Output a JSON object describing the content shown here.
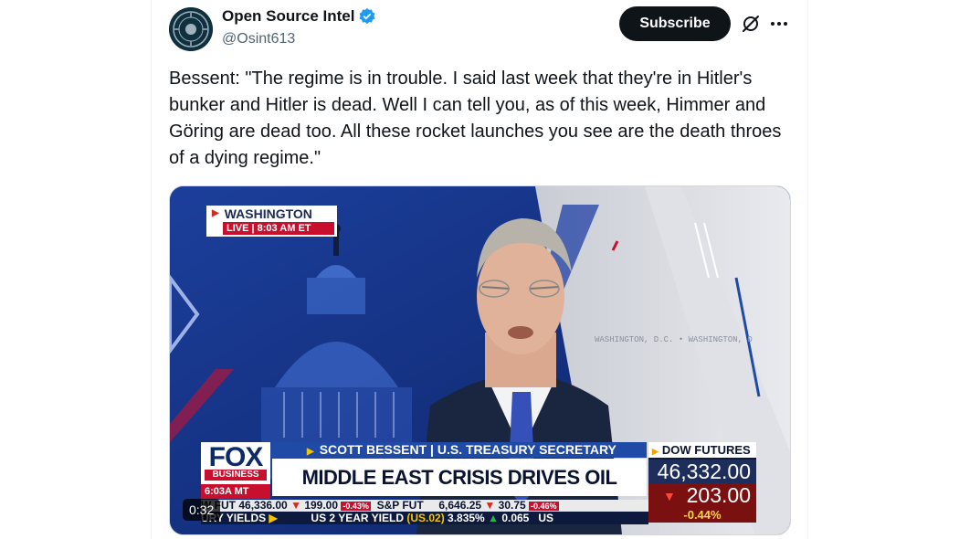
{
  "account": {
    "display_name": "Open Source Intel",
    "handle": "@Osint613",
    "verified_icon": "verified-badge-icon",
    "avatar_icon": "seal-avatar-icon"
  },
  "actions": {
    "subscribe_label": "Subscribe",
    "grok_icon": "grok-icon",
    "more_icon": "more-horizontal-icon"
  },
  "tweet": {
    "text": "Bessent: \"The regime is in trouble. I said last week that they're in Hitler's bunker and Hitler is dead. Well I can tell you, as of this week, Himmer and Göring are dead too. All these rocket launches you see are the death throes of a dying regime.\""
  },
  "video": {
    "duration": "0:32",
    "location": "WASHINGTON",
    "live_time": "LIVE | 8:03 AM ET",
    "wall_text": "WASHINGTON, D.C. • WASHINGTON, D",
    "logo_word": "FOX",
    "logo_sub": "BUSINESS",
    "local_time": "6:03A MT",
    "name_line": "SCOTT BESSENT | U.S. TREASURY SECRETARY",
    "headline": "MIDDLE EAST CRISIS DRIVES OIL SHARPLY HIGHER",
    "dow": {
      "title": "DOW FUTURES",
      "value": "46,332.00",
      "change": "203.00",
      "pct": "-0.44%"
    },
    "ticker1": {
      "a_label": "W FUT",
      "a_value": "46,336.00",
      "a_change": "199.00",
      "a_pct": "-0.43%",
      "b_label": "S&P FUT",
      "b_value": "6,646.25",
      "b_change": "30.75",
      "b_pct": "-0.46%"
    },
    "ticker2": {
      "label": "URY YIELDS",
      "item": "US 2 YEAR YIELD",
      "symbol": "(US.02)",
      "value": "3.835%",
      "change": "0.065",
      "tail": "US"
    }
  },
  "colors": {
    "fox_navy": "#0a2b6b",
    "fox_red": "#c8102e",
    "name_blue": "#1f4aa6"
  }
}
